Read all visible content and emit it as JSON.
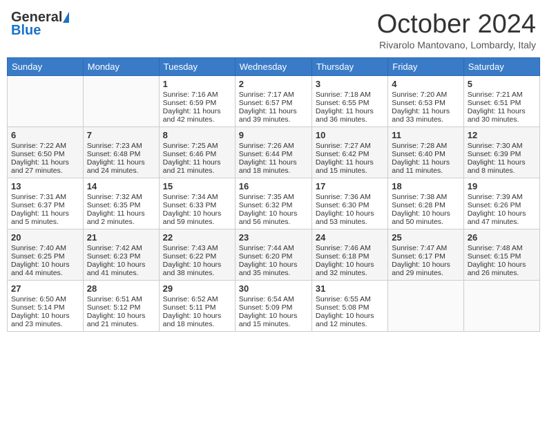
{
  "header": {
    "logo_general": "General",
    "logo_blue": "Blue",
    "month_title": "October 2024",
    "subtitle": "Rivarolo Mantovano, Lombardy, Italy"
  },
  "days_of_week": [
    "Sunday",
    "Monday",
    "Tuesday",
    "Wednesday",
    "Thursday",
    "Friday",
    "Saturday"
  ],
  "weeks": [
    [
      {
        "day": "",
        "sunrise": "",
        "sunset": "",
        "daylight": ""
      },
      {
        "day": "",
        "sunrise": "",
        "sunset": "",
        "daylight": ""
      },
      {
        "day": "1",
        "sunrise": "Sunrise: 7:16 AM",
        "sunset": "Sunset: 6:59 PM",
        "daylight": "Daylight: 11 hours and 42 minutes."
      },
      {
        "day": "2",
        "sunrise": "Sunrise: 7:17 AM",
        "sunset": "Sunset: 6:57 PM",
        "daylight": "Daylight: 11 hours and 39 minutes."
      },
      {
        "day": "3",
        "sunrise": "Sunrise: 7:18 AM",
        "sunset": "Sunset: 6:55 PM",
        "daylight": "Daylight: 11 hours and 36 minutes."
      },
      {
        "day": "4",
        "sunrise": "Sunrise: 7:20 AM",
        "sunset": "Sunset: 6:53 PM",
        "daylight": "Daylight: 11 hours and 33 minutes."
      },
      {
        "day": "5",
        "sunrise": "Sunrise: 7:21 AM",
        "sunset": "Sunset: 6:51 PM",
        "daylight": "Daylight: 11 hours and 30 minutes."
      }
    ],
    [
      {
        "day": "6",
        "sunrise": "Sunrise: 7:22 AM",
        "sunset": "Sunset: 6:50 PM",
        "daylight": "Daylight: 11 hours and 27 minutes."
      },
      {
        "day": "7",
        "sunrise": "Sunrise: 7:23 AM",
        "sunset": "Sunset: 6:48 PM",
        "daylight": "Daylight: 11 hours and 24 minutes."
      },
      {
        "day": "8",
        "sunrise": "Sunrise: 7:25 AM",
        "sunset": "Sunset: 6:46 PM",
        "daylight": "Daylight: 11 hours and 21 minutes."
      },
      {
        "day": "9",
        "sunrise": "Sunrise: 7:26 AM",
        "sunset": "Sunset: 6:44 PM",
        "daylight": "Daylight: 11 hours and 18 minutes."
      },
      {
        "day": "10",
        "sunrise": "Sunrise: 7:27 AM",
        "sunset": "Sunset: 6:42 PM",
        "daylight": "Daylight: 11 hours and 15 minutes."
      },
      {
        "day": "11",
        "sunrise": "Sunrise: 7:28 AM",
        "sunset": "Sunset: 6:40 PM",
        "daylight": "Daylight: 11 hours and 11 minutes."
      },
      {
        "day": "12",
        "sunrise": "Sunrise: 7:30 AM",
        "sunset": "Sunset: 6:39 PM",
        "daylight": "Daylight: 11 hours and 8 minutes."
      }
    ],
    [
      {
        "day": "13",
        "sunrise": "Sunrise: 7:31 AM",
        "sunset": "Sunset: 6:37 PM",
        "daylight": "Daylight: 11 hours and 5 minutes."
      },
      {
        "day": "14",
        "sunrise": "Sunrise: 7:32 AM",
        "sunset": "Sunset: 6:35 PM",
        "daylight": "Daylight: 11 hours and 2 minutes."
      },
      {
        "day": "15",
        "sunrise": "Sunrise: 7:34 AM",
        "sunset": "Sunset: 6:33 PM",
        "daylight": "Daylight: 10 hours and 59 minutes."
      },
      {
        "day": "16",
        "sunrise": "Sunrise: 7:35 AM",
        "sunset": "Sunset: 6:32 PM",
        "daylight": "Daylight: 10 hours and 56 minutes."
      },
      {
        "day": "17",
        "sunrise": "Sunrise: 7:36 AM",
        "sunset": "Sunset: 6:30 PM",
        "daylight": "Daylight: 10 hours and 53 minutes."
      },
      {
        "day": "18",
        "sunrise": "Sunrise: 7:38 AM",
        "sunset": "Sunset: 6:28 PM",
        "daylight": "Daylight: 10 hours and 50 minutes."
      },
      {
        "day": "19",
        "sunrise": "Sunrise: 7:39 AM",
        "sunset": "Sunset: 6:26 PM",
        "daylight": "Daylight: 10 hours and 47 minutes."
      }
    ],
    [
      {
        "day": "20",
        "sunrise": "Sunrise: 7:40 AM",
        "sunset": "Sunset: 6:25 PM",
        "daylight": "Daylight: 10 hours and 44 minutes."
      },
      {
        "day": "21",
        "sunrise": "Sunrise: 7:42 AM",
        "sunset": "Sunset: 6:23 PM",
        "daylight": "Daylight: 10 hours and 41 minutes."
      },
      {
        "day": "22",
        "sunrise": "Sunrise: 7:43 AM",
        "sunset": "Sunset: 6:22 PM",
        "daylight": "Daylight: 10 hours and 38 minutes."
      },
      {
        "day": "23",
        "sunrise": "Sunrise: 7:44 AM",
        "sunset": "Sunset: 6:20 PM",
        "daylight": "Daylight: 10 hours and 35 minutes."
      },
      {
        "day": "24",
        "sunrise": "Sunrise: 7:46 AM",
        "sunset": "Sunset: 6:18 PM",
        "daylight": "Daylight: 10 hours and 32 minutes."
      },
      {
        "day": "25",
        "sunrise": "Sunrise: 7:47 AM",
        "sunset": "Sunset: 6:17 PM",
        "daylight": "Daylight: 10 hours and 29 minutes."
      },
      {
        "day": "26",
        "sunrise": "Sunrise: 7:48 AM",
        "sunset": "Sunset: 6:15 PM",
        "daylight": "Daylight: 10 hours and 26 minutes."
      }
    ],
    [
      {
        "day": "27",
        "sunrise": "Sunrise: 6:50 AM",
        "sunset": "Sunset: 5:14 PM",
        "daylight": "Daylight: 10 hours and 23 minutes."
      },
      {
        "day": "28",
        "sunrise": "Sunrise: 6:51 AM",
        "sunset": "Sunset: 5:12 PM",
        "daylight": "Daylight: 10 hours and 21 minutes."
      },
      {
        "day": "29",
        "sunrise": "Sunrise: 6:52 AM",
        "sunset": "Sunset: 5:11 PM",
        "daylight": "Daylight: 10 hours and 18 minutes."
      },
      {
        "day": "30",
        "sunrise": "Sunrise: 6:54 AM",
        "sunset": "Sunset: 5:09 PM",
        "daylight": "Daylight: 10 hours and 15 minutes."
      },
      {
        "day": "31",
        "sunrise": "Sunrise: 6:55 AM",
        "sunset": "Sunset: 5:08 PM",
        "daylight": "Daylight: 10 hours and 12 minutes."
      },
      {
        "day": "",
        "sunrise": "",
        "sunset": "",
        "daylight": ""
      },
      {
        "day": "",
        "sunrise": "",
        "sunset": "",
        "daylight": ""
      }
    ]
  ]
}
